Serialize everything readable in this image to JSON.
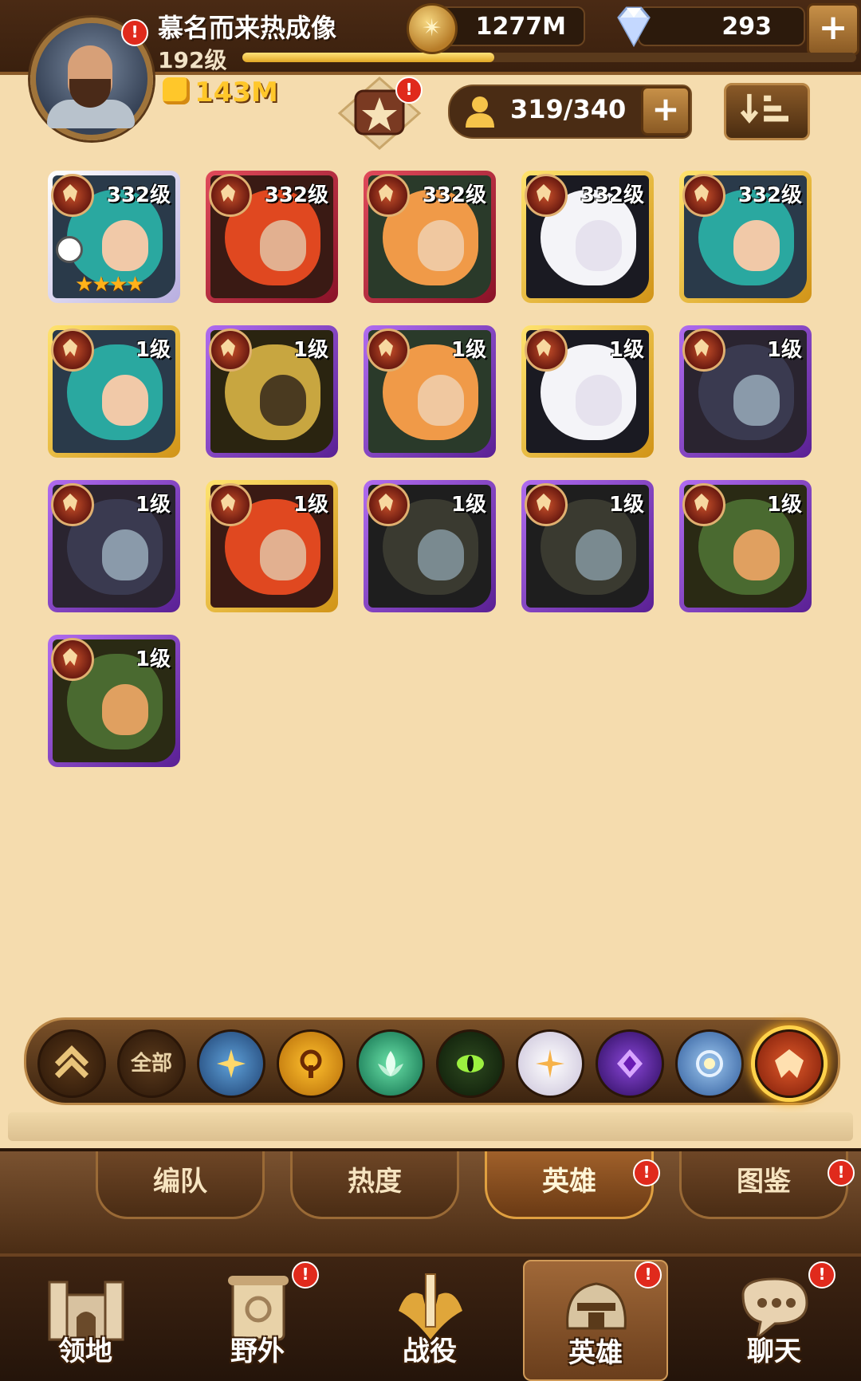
{
  "player": {
    "name": "慕名而来热成像",
    "level": "192级",
    "xp_progress": 0.41,
    "power": "143M"
  },
  "resources": {
    "gold": "1277M",
    "diamonds": "293"
  },
  "roster": {
    "count": "319/340"
  },
  "heroes": [
    {
      "level": "332级",
      "border": "silver",
      "stars": "★★★★",
      "timed": true
    },
    {
      "level": "332级",
      "border": "red"
    },
    {
      "level": "332级",
      "border": "red"
    },
    {
      "level": "332级",
      "border": "gold"
    },
    {
      "level": "332级",
      "border": "gold"
    },
    {
      "level": "1级",
      "border": "gold"
    },
    {
      "level": "1级",
      "border": "purple"
    },
    {
      "level": "1级",
      "border": "purple"
    },
    {
      "level": "1级",
      "border": "gold"
    },
    {
      "level": "1级",
      "border": "purple"
    },
    {
      "level": "1级",
      "border": "purple"
    },
    {
      "level": "1级",
      "border": "gold"
    },
    {
      "level": "1级",
      "border": "purple"
    },
    {
      "level": "1级",
      "border": "purple"
    },
    {
      "level": "1级",
      "border": "purple"
    },
    {
      "level": "1级",
      "border": "purple"
    }
  ],
  "filters": {
    "all_label": "全部",
    "factions": [
      "lightbearer",
      "mauler",
      "wilder",
      "graveborn",
      "celestial",
      "hypogean",
      "dimensional",
      "draconis"
    ],
    "selected": "draconis"
  },
  "subtabs": [
    {
      "label": "编队",
      "active": false,
      "badge": false
    },
    {
      "label": "热度",
      "active": false,
      "badge": false
    },
    {
      "label": "英雄",
      "active": true,
      "badge": true
    },
    {
      "label": "图鉴",
      "active": false,
      "badge": true
    }
  ],
  "nav": [
    {
      "label": "领地",
      "icon": "castle-icon",
      "badge": false,
      "active": false
    },
    {
      "label": "野外",
      "icon": "scroll-map-icon",
      "badge": true,
      "active": false
    },
    {
      "label": "战役",
      "icon": "sword-icon",
      "badge": false,
      "active": false
    },
    {
      "label": "英雄",
      "icon": "helmet-icon",
      "badge": true,
      "active": true
    },
    {
      "label": "聊天",
      "icon": "chat-bubble-icon",
      "badge": true,
      "active": false
    }
  ],
  "badge_glyph": "!",
  "colors": {
    "accent_gold": "#ffc72a",
    "badge_red": "#e02a1c",
    "panel_bg": "#f5dcae"
  }
}
